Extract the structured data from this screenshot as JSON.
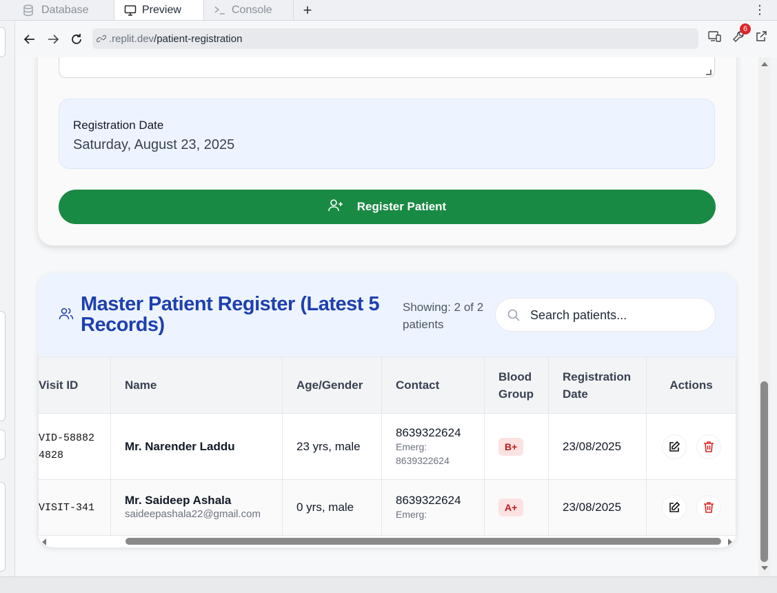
{
  "tabs": [
    {
      "label": "Database",
      "icon": "database-icon"
    },
    {
      "label": "Preview",
      "icon": "monitor-icon"
    },
    {
      "label": "Console",
      "icon": "terminal-icon"
    }
  ],
  "address": {
    "url_domain": ".replit.dev",
    "url_path": "/patient-registration",
    "devtools_badge": "6"
  },
  "registration": {
    "date_label": "Registration Date",
    "date_value": "Saturday, August 23, 2025",
    "register_button": "Register Patient"
  },
  "register_table": {
    "title": "Master Patient Register (Latest 5 Records)",
    "showing": "Showing: 2 of 2 patients",
    "search_placeholder": "Search patients...",
    "columns": [
      "Visit ID",
      "Name",
      "Age/Gender",
      "Contact",
      "Blood Group",
      "Registration Date",
      "Actions"
    ],
    "rows": [
      {
        "visit_id": "VID-588824828",
        "name": "Mr. Narender Laddu",
        "email": "",
        "age_gender": "23 yrs, male",
        "contact": "8639322624",
        "emergency": "Emerg: 8639322624",
        "blood": "B+",
        "reg_date": "23/08/2025"
      },
      {
        "visit_id": "VISIT-341",
        "name": "Mr. Saideep Ashala",
        "email": "saideepashala22@gmail.com",
        "age_gender": "0 yrs, male",
        "contact": "8639322624",
        "emergency": "Emerg:",
        "blood": "A+",
        "reg_date": "23/08/2025"
      }
    ]
  },
  "colors": {
    "accent_green": "#198a44",
    "title_blue": "#1e40af",
    "blood_badge_bg": "#fde2e2",
    "delete_red": "#dc2626"
  }
}
